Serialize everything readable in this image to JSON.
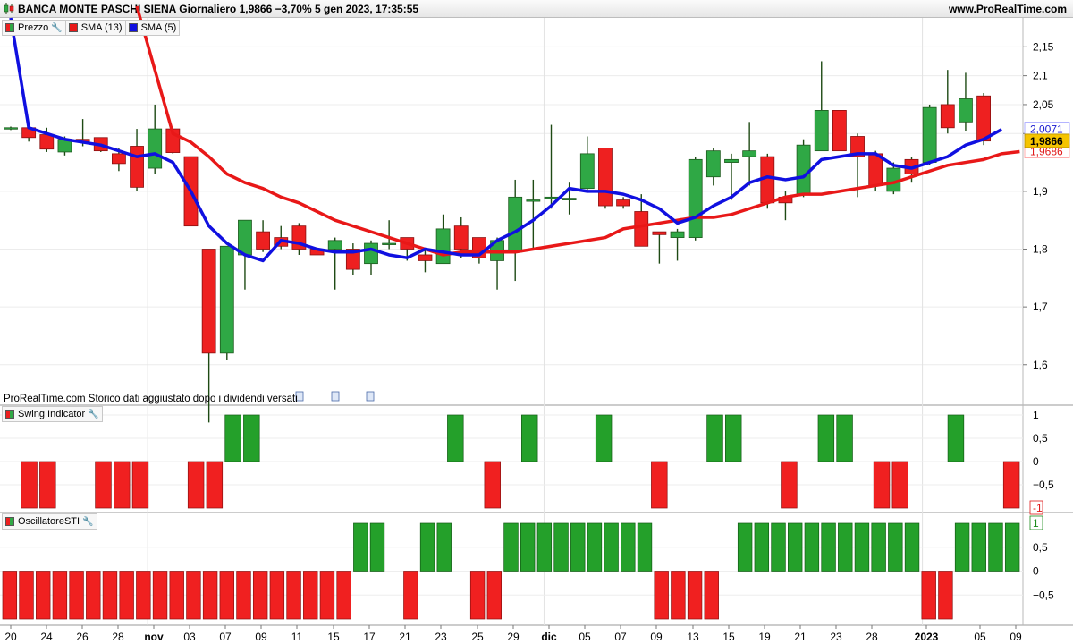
{
  "window": {
    "title": "BANCA MONTE PASCHI SIENA Giornaliero 1,9866 −3,70% 5 gen 2023, 17:35:55",
    "brand": "www.ProRealTime.com"
  },
  "legends": {
    "price": [
      {
        "label": "Prezzo",
        "color": "#2e8b3a",
        "icon": "wrench-icon"
      },
      {
        "label": "SMA (13)",
        "color": "#e81818"
      },
      {
        "label": "SMA (5)",
        "color": "#1010e0"
      }
    ],
    "swing": {
      "label": "Swing Indicator",
      "icon": "wrench-icon"
    },
    "sti": {
      "label": "OscillatoreSTI",
      "icon": "wrench-icon"
    }
  },
  "note": "ProRealTime.com  Storico dati aggiustato dopo i dividendi versati",
  "price_labels": {
    "sma5": "2,0071",
    "last": "1,9866",
    "sma13": "1,9686"
  },
  "indicator_labels": {
    "swing_last": "-1",
    "sti_last": "1"
  },
  "colors": {
    "up": "#2fa845",
    "down": "#ee2020",
    "wick": "#1e4a14",
    "sma13": "#e81818",
    "sma5": "#1010e0",
    "last_bg": "#f5c400"
  },
  "chart_data": [
    {
      "type": "candlestick",
      "title": "BANCA MONTE PASCHI SIENA",
      "x_tick_labels": [
        "20",
        "24",
        "26",
        "28",
        "nov",
        "03",
        "07",
        "09",
        "11",
        "15",
        "17",
        "21",
        "23",
        "25",
        "29",
        "dic",
        "05",
        "07",
        "09",
        "13",
        "15",
        "19",
        "21",
        "23",
        "28",
        "2023",
        "05",
        "09"
      ],
      "y_ticks": [
        "2,15",
        "2,1",
        "2,05",
        "2",
        "1,9",
        "1,8",
        "1,7",
        "1,6"
      ],
      "y_tick_values": [
        2.15,
        2.1,
        2.05,
        2.0,
        1.9,
        1.8,
        1.7,
        1.6
      ],
      "ylim": [
        1.53,
        2.2
      ],
      "candles": [
        {
          "o": 2.008,
          "h": 2.012,
          "l": 2.006,
          "c": 2.01
        },
        {
          "o": 2.01,
          "h": 2.012,
          "l": 1.986,
          "c": 1.993
        },
        {
          "o": 1.998,
          "h": 2.01,
          "l": 1.968,
          "c": 1.973
        },
        {
          "o": 1.968,
          "h": 1.995,
          "l": 1.962,
          "c": 1.99
        },
        {
          "o": 1.99,
          "h": 2.025,
          "l": 1.978,
          "c": 1.986
        },
        {
          "o": 1.993,
          "h": 1.993,
          "l": 1.968,
          "c": 1.97
        },
        {
          "o": 1.965,
          "h": 1.975,
          "l": 1.935,
          "c": 1.948
        },
        {
          "o": 1.978,
          "h": 2.008,
          "l": 1.9,
          "c": 1.907
        },
        {
          "o": 1.94,
          "h": 2.05,
          "l": 1.93,
          "c": 2.008
        },
        {
          "o": 2.008,
          "h": 2.008,
          "l": 1.965,
          "c": 1.967
        },
        {
          "o": 1.96,
          "h": 1.96,
          "l": 1.84,
          "c": 1.84
        },
        {
          "o": 1.8,
          "h": 1.8,
          "l": 1.5,
          "c": 1.62
        },
        {
          "o": 1.62,
          "h": 1.805,
          "l": 1.608,
          "c": 1.805
        },
        {
          "o": 1.79,
          "h": 1.85,
          "l": 1.73,
          "c": 1.85
        },
        {
          "o": 1.83,
          "h": 1.85,
          "l": 1.795,
          "c": 1.8
        },
        {
          "o": 1.82,
          "h": 1.84,
          "l": 1.8,
          "c": 1.805
        },
        {
          "o": 1.84,
          "h": 1.845,
          "l": 1.79,
          "c": 1.8
        },
        {
          "o": 1.8,
          "h": 1.8,
          "l": 1.79,
          "c": 1.79
        },
        {
          "o": 1.8,
          "h": 1.82,
          "l": 1.73,
          "c": 1.815
        },
        {
          "o": 1.8,
          "h": 1.81,
          "l": 1.755,
          "c": 1.765
        },
        {
          "o": 1.775,
          "h": 1.815,
          "l": 1.755,
          "c": 1.81
        },
        {
          "o": 1.81,
          "h": 1.85,
          "l": 1.8,
          "c": 1.81
        },
        {
          "o": 1.82,
          "h": 1.82,
          "l": 1.78,
          "c": 1.8
        },
        {
          "o": 1.79,
          "h": 1.8,
          "l": 1.76,
          "c": 1.78
        },
        {
          "o": 1.775,
          "h": 1.86,
          "l": 1.775,
          "c": 1.835
        },
        {
          "o": 1.84,
          "h": 1.855,
          "l": 1.785,
          "c": 1.8
        },
        {
          "o": 1.82,
          "h": 1.82,
          "l": 1.775,
          "c": 1.785
        },
        {
          "o": 1.78,
          "h": 1.82,
          "l": 1.73,
          "c": 1.815
        },
        {
          "o": 1.795,
          "h": 1.92,
          "l": 1.745,
          "c": 1.89
        },
        {
          "o": 1.885,
          "h": 1.92,
          "l": 1.8,
          "c": 1.885
        },
        {
          "o": 1.888,
          "h": 2.015,
          "l": 1.87,
          "c": 1.89
        },
        {
          "o": 1.885,
          "h": 1.915,
          "l": 1.86,
          "c": 1.888
        },
        {
          "o": 1.905,
          "h": 1.995,
          "l": 1.9,
          "c": 1.965
        },
        {
          "o": 1.975,
          "h": 1.975,
          "l": 1.87,
          "c": 1.875
        },
        {
          "o": 1.885,
          "h": 1.89,
          "l": 1.87,
          "c": 1.875
        },
        {
          "o": 1.865,
          "h": 1.895,
          "l": 1.805,
          "c": 1.805
        },
        {
          "o": 1.83,
          "h": 1.83,
          "l": 1.775,
          "c": 1.825
        },
        {
          "o": 1.82,
          "h": 1.835,
          "l": 1.78,
          "c": 1.83
        },
        {
          "o": 1.82,
          "h": 1.96,
          "l": 1.815,
          "c": 1.955
        },
        {
          "o": 1.925,
          "h": 1.975,
          "l": 1.91,
          "c": 1.97
        },
        {
          "o": 1.95,
          "h": 1.965,
          "l": 1.885,
          "c": 1.955
        },
        {
          "o": 1.96,
          "h": 2.02,
          "l": 1.91,
          "c": 1.97
        },
        {
          "o": 1.96,
          "h": 1.965,
          "l": 1.87,
          "c": 1.88
        },
        {
          "o": 1.89,
          "h": 1.9,
          "l": 1.85,
          "c": 1.88
        },
        {
          "o": 1.895,
          "h": 1.99,
          "l": 1.89,
          "c": 1.98
        },
        {
          "o": 1.97,
          "h": 2.125,
          "l": 1.97,
          "c": 2.04
        },
        {
          "o": 2.04,
          "h": 2.04,
          "l": 1.97,
          "c": 1.97
        },
        {
          "o": 1.995,
          "h": 2.0,
          "l": 1.89,
          "c": 1.96
        },
        {
          "o": 1.965,
          "h": 1.97,
          "l": 1.9,
          "c": 1.91
        },
        {
          "o": 1.9,
          "h": 1.95,
          "l": 1.895,
          "c": 1.94
        },
        {
          "o": 1.955,
          "h": 1.96,
          "l": 1.915,
          "c": 1.93
        },
        {
          "o": 1.95,
          "h": 2.05,
          "l": 1.945,
          "c": 2.045
        },
        {
          "o": 2.05,
          "h": 2.11,
          "l": 2.0,
          "c": 2.01
        },
        {
          "o": 2.02,
          "h": 2.105,
          "l": 2.005,
          "c": 2.06
        },
        {
          "o": 2.065,
          "h": 2.07,
          "l": 1.98,
          "c": 1.987
        }
      ],
      "sma13": [
        null,
        null,
        null,
        null,
        null,
        null,
        null,
        2.22,
        2.11,
        2.0,
        1.985,
        1.96,
        1.93,
        1.915,
        1.905,
        1.89,
        1.88,
        1.865,
        1.85,
        1.84,
        1.83,
        1.82,
        1.81,
        1.8,
        1.79,
        1.795,
        1.795,
        1.795,
        1.795,
        1.8,
        1.805,
        1.81,
        1.815,
        1.82,
        1.835,
        1.84,
        1.845,
        1.85,
        1.855,
        1.855,
        1.86,
        1.87,
        1.88,
        1.89,
        1.895,
        1.895,
        1.9,
        1.905,
        1.91,
        1.915,
        1.925,
        1.935,
        1.945,
        1.95,
        1.955,
        1.965,
        1.9686
      ],
      "sma5": [
        2.2,
        2.01,
        2.0,
        1.99,
        1.985,
        1.98,
        1.97,
        1.96,
        1.965,
        1.95,
        1.9,
        1.84,
        1.81,
        1.79,
        1.78,
        1.815,
        1.81,
        1.8,
        1.795,
        1.795,
        1.8,
        1.79,
        1.785,
        1.8,
        1.795,
        1.79,
        1.79,
        1.815,
        1.83,
        1.85,
        1.875,
        1.905,
        1.9,
        1.9,
        1.895,
        1.885,
        1.87,
        1.845,
        1.855,
        1.875,
        1.89,
        1.915,
        1.925,
        1.92,
        1.925,
        1.955,
        1.96,
        1.965,
        1.965,
        1.945,
        1.94,
        1.95,
        1.96,
        1.98,
        1.99,
        2.0071
      ]
    },
    {
      "type": "bar",
      "title": "Swing Indicator",
      "ylim": [
        -1,
        1
      ],
      "y_ticks": [
        "1",
        "0,5",
        "0",
        "−0,5"
      ],
      "y_tick_values": [
        1,
        0.5,
        0,
        -0.5
      ],
      "values": [
        0,
        -1,
        -1,
        0,
        0,
        -1,
        -1,
        -1,
        0,
        0,
        -1,
        -1,
        1,
        1,
        0,
        0,
        0,
        0,
        0,
        0,
        0,
        0,
        0,
        0,
        1,
        0,
        -1,
        0,
        1,
        0,
        0,
        0,
        1,
        0,
        0,
        -1,
        0,
        0,
        1,
        1,
        0,
        0,
        -1,
        0,
        1,
        1,
        0,
        -1,
        -1,
        0,
        0,
        1,
        0,
        0,
        -1
      ]
    },
    {
      "type": "bar",
      "title": "OscillatoreSTI",
      "ylim": [
        -1,
        1
      ],
      "y_ticks": [
        "0,5",
        "0",
        "−0,5"
      ],
      "y_tick_values": [
        0.5,
        0,
        -0.5
      ],
      "values": [
        -1,
        -1,
        -1,
        -1,
        -1,
        -1,
        -1,
        -1,
        -1,
        -1,
        -1,
        -1,
        -1,
        -1,
        -1,
        -1,
        -1,
        -1,
        -1,
        -1,
        -1,
        1,
        1,
        0,
        -1,
        1,
        1,
        0,
        -1,
        -1,
        1,
        1,
        1,
        1,
        1,
        1,
        1,
        1,
        1,
        -1,
        -1,
        -1,
        -1,
        0,
        1,
        1,
        1,
        1,
        1,
        1,
        1,
        1,
        1,
        1,
        1,
        -1,
        -1,
        1,
        1,
        1,
        1
      ]
    }
  ]
}
